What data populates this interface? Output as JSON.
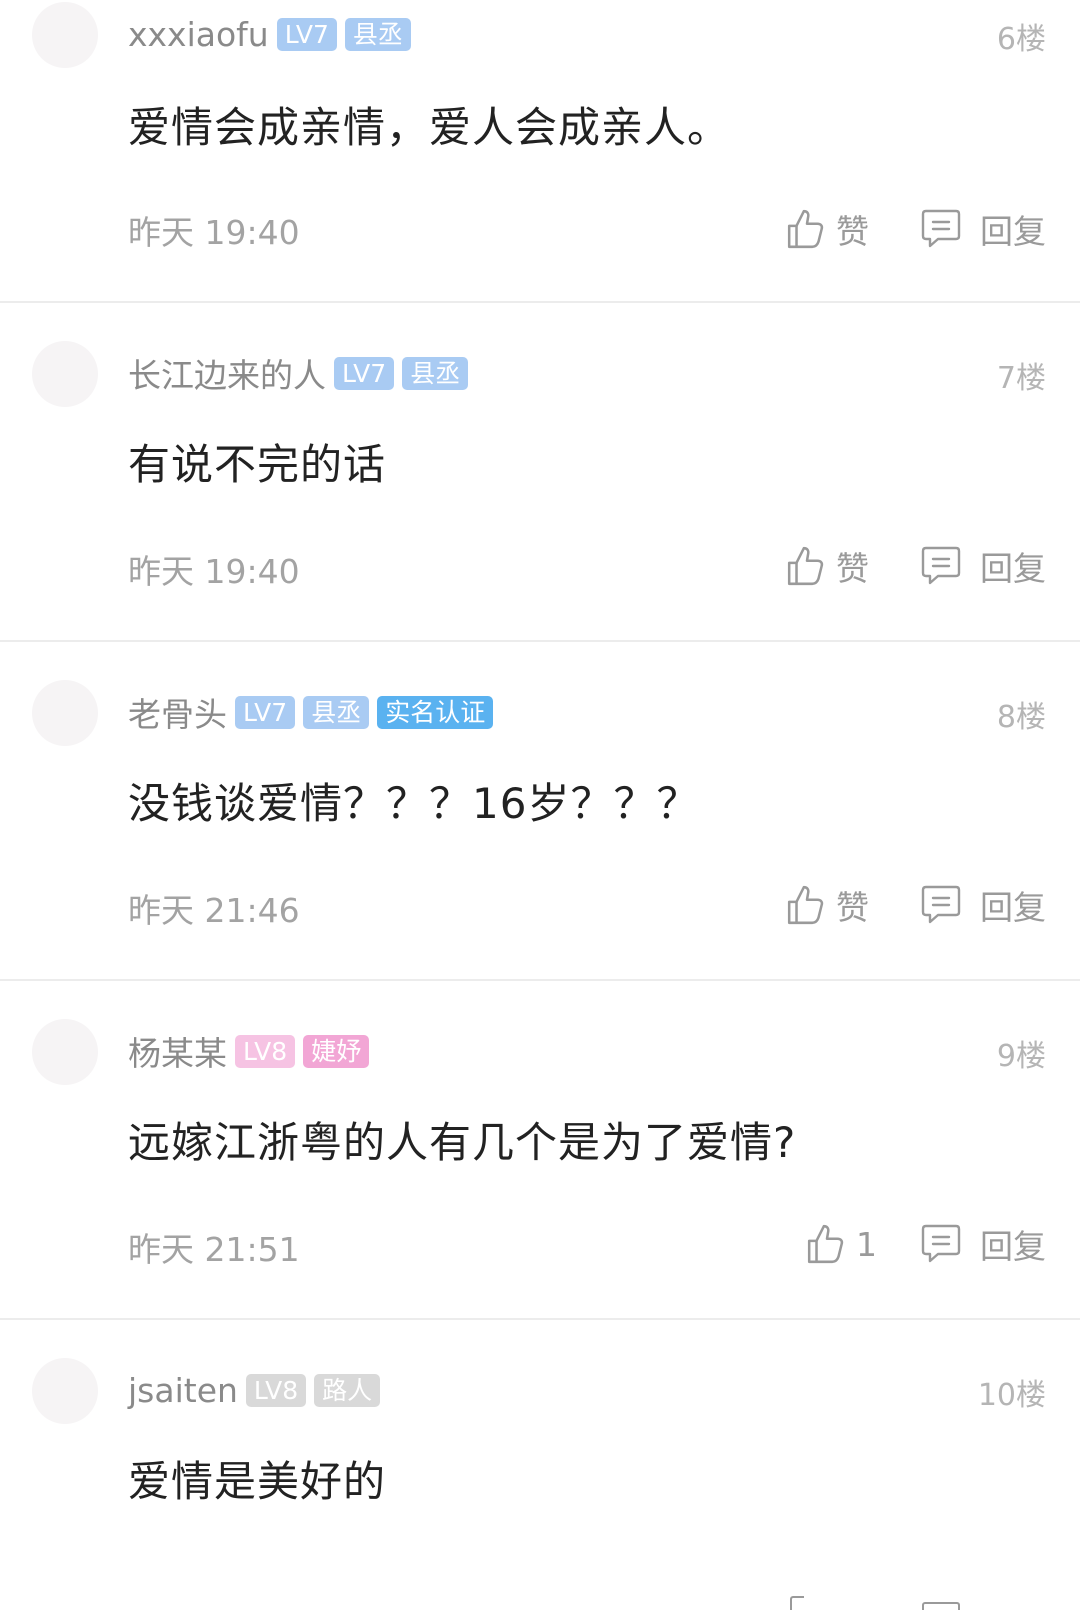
{
  "comments": [
    {
      "username": "xxxiaofu",
      "badges": [
        "LV7",
        "县丞"
      ],
      "floor": "6楼",
      "content": "爱情会成亲情，爱人会成亲人。",
      "time": "昨天 19:40",
      "like_label": "赞",
      "reply_label": "回复"
    },
    {
      "username": "长江边来的人",
      "badges": [
        "LV7",
        "县丞"
      ],
      "floor": "7楼",
      "content": "有说不完的话",
      "time": "昨天 19:40",
      "like_label": "赞",
      "reply_label": "回复"
    },
    {
      "username": "老骨头",
      "badges": [
        "LV7",
        "县丞",
        "实名认证"
      ],
      "floor": "8楼",
      "content": "没钱谈爱情？？？16岁？？？",
      "time": "昨天 21:46",
      "like_label": "赞",
      "reply_label": "回复"
    },
    {
      "username": "杨某某",
      "badges": [
        "LV8",
        "婕妤"
      ],
      "floor": "9楼",
      "content": "远嫁江浙粤的人有几个是为了爱情?",
      "time": "昨天 21:51",
      "like_label": "1",
      "reply_label": "回复"
    },
    {
      "username": "jsaiten",
      "badges": [
        "LV8",
        "路人"
      ],
      "floor": "10楼",
      "content": "爱情是美好的"
    }
  ],
  "colors": {
    "badge_blue": "#a9cbf3",
    "badge_verified": "#5ab2f0",
    "badge_pink_lv": "#f6c3e3",
    "badge_pink_title": "#f2a6d5",
    "badge_gray": "#d9d9d9"
  },
  "icons": {
    "like": "thumbs-up-icon",
    "reply": "comment-bubble-icon"
  }
}
